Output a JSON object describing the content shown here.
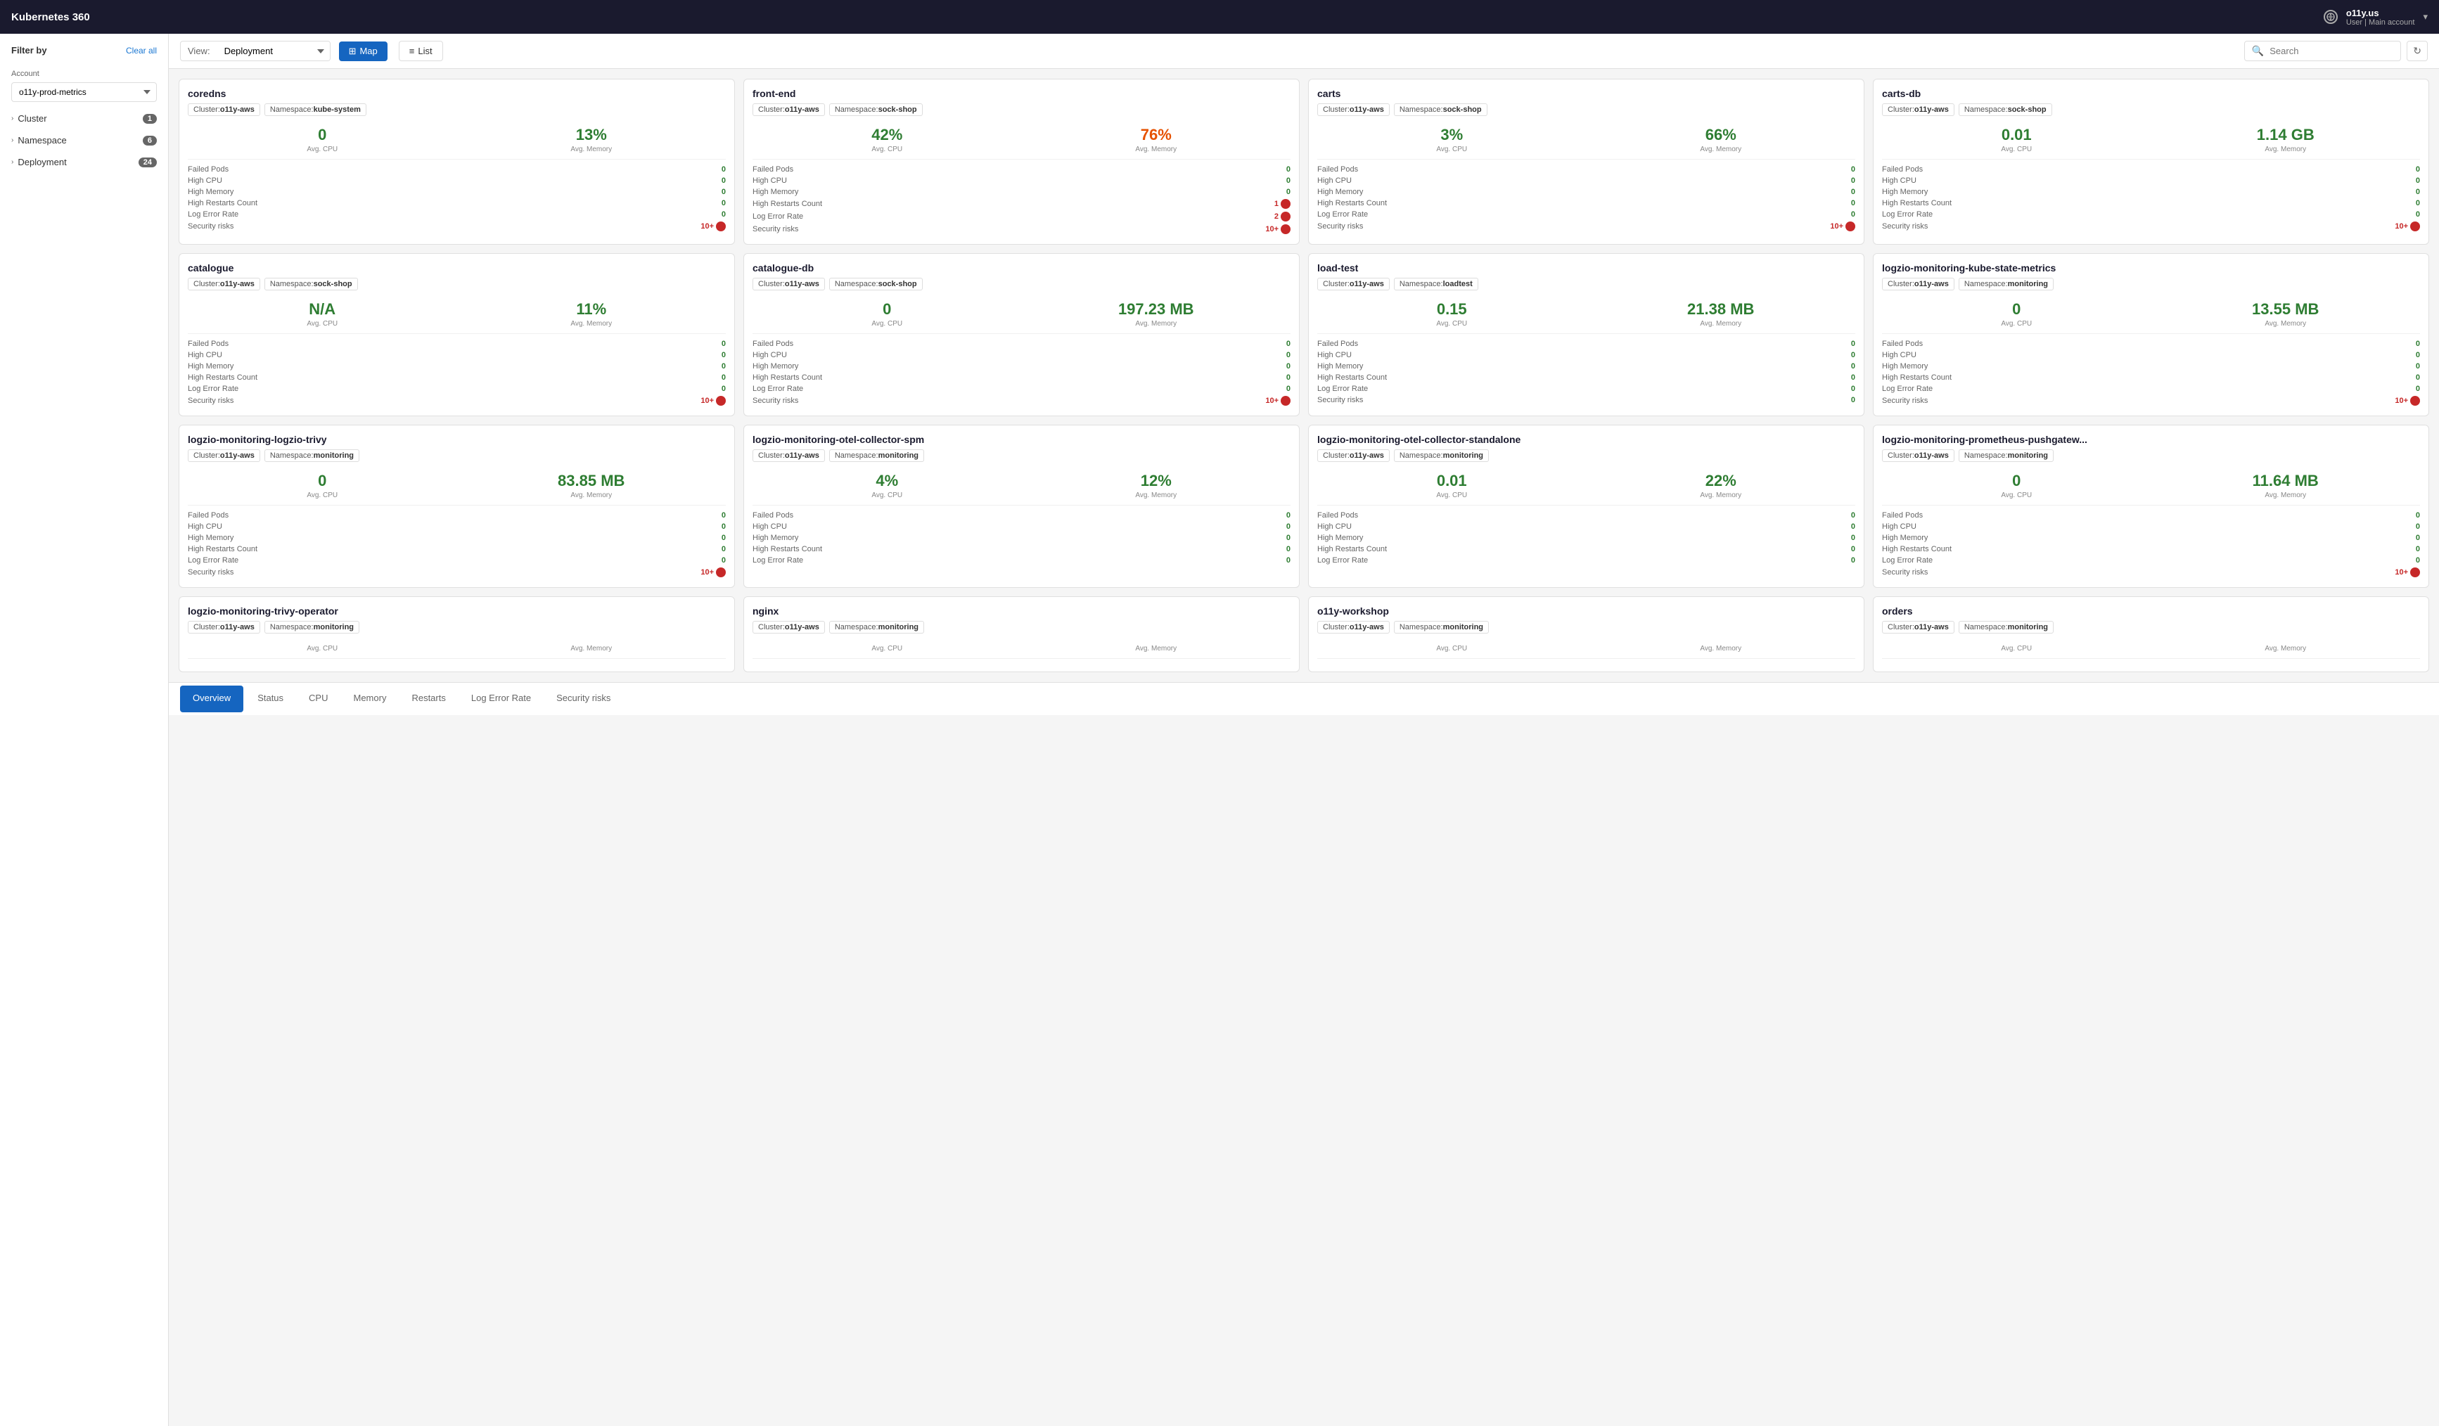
{
  "topbar": {
    "title": "Kubernetes 360",
    "help_label": "Help",
    "user_name": "o11y.us",
    "user_role": "User",
    "user_account": "Main account"
  },
  "sidebar": {
    "filter_title": "Filter by",
    "clear_all_label": "Clear all",
    "account_label": "Account",
    "account_value": "o11y-prod-metrics",
    "filters": [
      {
        "name": "Cluster",
        "count": "1"
      },
      {
        "name": "Namespace",
        "count": "6"
      },
      {
        "name": "Deployment",
        "count": "24"
      }
    ]
  },
  "toolbar": {
    "view_label": "View:",
    "view_value": "Deployment",
    "map_label": "Map",
    "list_label": "List",
    "search_placeholder": "Search",
    "refresh_icon": "↻"
  },
  "cards": [
    {
      "title": "coredns",
      "cluster": "o11y-aws",
      "namespace": "kube-system",
      "cpu": "0",
      "cpu_color": "green",
      "memory": "13%",
      "memory_color": "green",
      "cpu_label": "Avg. CPU",
      "memory_label": "Avg. Memory",
      "rows": [
        {
          "label": "Failed Pods",
          "value": "0",
          "color": "green"
        },
        {
          "label": "High CPU",
          "value": "0",
          "color": "green"
        },
        {
          "label": "High Memory",
          "value": "0",
          "color": "green"
        },
        {
          "label": "High Restarts Count",
          "value": "0",
          "color": "green"
        },
        {
          "label": "Log Error Rate",
          "value": "0",
          "color": "green"
        },
        {
          "label": "Security risks",
          "value": "10+",
          "color": "red",
          "dot": true
        }
      ]
    },
    {
      "title": "front-end",
      "cluster": "o11y-aws",
      "namespace": "sock-shop",
      "cpu": "42%",
      "cpu_color": "green",
      "memory": "76%",
      "memory_color": "orange",
      "cpu_label": "Avg. CPU",
      "memory_label": "Avg. Memory",
      "rows": [
        {
          "label": "Failed Pods",
          "value": "0",
          "color": "green"
        },
        {
          "label": "High CPU",
          "value": "0",
          "color": "green"
        },
        {
          "label": "High Memory",
          "value": "0",
          "color": "green"
        },
        {
          "label": "High Restarts Count",
          "value": "1",
          "color": "red",
          "dot": true
        },
        {
          "label": "Log Error Rate",
          "value": "2",
          "color": "red",
          "dot": true
        },
        {
          "label": "Security risks",
          "value": "10+",
          "color": "red",
          "dot": true
        }
      ]
    },
    {
      "title": "carts",
      "cluster": "o11y-aws",
      "namespace": "sock-shop",
      "cpu": "3%",
      "cpu_color": "green",
      "memory": "66%",
      "memory_color": "green",
      "cpu_label": "Avg. CPU",
      "memory_label": "Avg. Memory",
      "rows": [
        {
          "label": "Failed Pods",
          "value": "0",
          "color": "green"
        },
        {
          "label": "High CPU",
          "value": "0",
          "color": "green"
        },
        {
          "label": "High Memory",
          "value": "0",
          "color": "green"
        },
        {
          "label": "High Restarts Count",
          "value": "0",
          "color": "green"
        },
        {
          "label": "Log Error Rate",
          "value": "0",
          "color": "green"
        },
        {
          "label": "Security risks",
          "value": "10+",
          "color": "red",
          "dot": true
        }
      ]
    },
    {
      "title": "carts-db",
      "cluster": "o11y-aws",
      "namespace": "sock-shop",
      "cpu": "0.01",
      "cpu_color": "green",
      "memory": "1.14 GB",
      "memory_color": "green",
      "cpu_label": "Avg. CPU",
      "memory_label": "Avg. Memory",
      "rows": [
        {
          "label": "Failed Pods",
          "value": "0",
          "color": "green"
        },
        {
          "label": "High CPU",
          "value": "0",
          "color": "green"
        },
        {
          "label": "High Memory",
          "value": "0",
          "color": "green"
        },
        {
          "label": "High Restarts Count",
          "value": "0",
          "color": "green"
        },
        {
          "label": "Log Error Rate",
          "value": "0",
          "color": "green"
        },
        {
          "label": "Security risks",
          "value": "10+",
          "color": "red",
          "dot": true
        }
      ]
    },
    {
      "title": "catalogue",
      "cluster": "o11y-aws",
      "namespace": "sock-shop",
      "cpu": "N/A",
      "cpu_color": "green",
      "memory": "11%",
      "memory_color": "green",
      "cpu_label": "Avg. CPU",
      "memory_label": "Avg. Memory",
      "rows": [
        {
          "label": "Failed Pods",
          "value": "0",
          "color": "green"
        },
        {
          "label": "High CPU",
          "value": "0",
          "color": "green"
        },
        {
          "label": "High Memory",
          "value": "0",
          "color": "green"
        },
        {
          "label": "High Restarts Count",
          "value": "0",
          "color": "green"
        },
        {
          "label": "Log Error Rate",
          "value": "0",
          "color": "green"
        },
        {
          "label": "Security risks",
          "value": "10+",
          "color": "red",
          "dot": true
        }
      ]
    },
    {
      "title": "catalogue-db",
      "cluster": "o11y-aws",
      "namespace": "sock-shop",
      "cpu": "0",
      "cpu_color": "green",
      "memory": "197.23 MB",
      "memory_color": "green",
      "cpu_label": "Avg. CPU",
      "memory_label": "Avg. Memory",
      "rows": [
        {
          "label": "Failed Pods",
          "value": "0",
          "color": "green"
        },
        {
          "label": "High CPU",
          "value": "0",
          "color": "green"
        },
        {
          "label": "High Memory",
          "value": "0",
          "color": "green"
        },
        {
          "label": "High Restarts Count",
          "value": "0",
          "color": "green"
        },
        {
          "label": "Log Error Rate",
          "value": "0",
          "color": "green"
        },
        {
          "label": "Security risks",
          "value": "10+",
          "color": "red",
          "dot": true
        }
      ]
    },
    {
      "title": "load-test",
      "cluster": "o11y-aws",
      "namespace": "loadtest",
      "cpu": "0.15",
      "cpu_color": "green",
      "memory": "21.38 MB",
      "memory_color": "green",
      "cpu_label": "Avg. CPU",
      "memory_label": "Avg. Memory",
      "rows": [
        {
          "label": "Failed Pods",
          "value": "0",
          "color": "green"
        },
        {
          "label": "High CPU",
          "value": "0",
          "color": "green"
        },
        {
          "label": "High Memory",
          "value": "0",
          "color": "green"
        },
        {
          "label": "High Restarts Count",
          "value": "0",
          "color": "green"
        },
        {
          "label": "Log Error Rate",
          "value": "0",
          "color": "green"
        },
        {
          "label": "Security risks",
          "value": "0",
          "color": "green"
        }
      ]
    },
    {
      "title": "logzio-monitoring-kube-state-metrics",
      "cluster": "o11y-aws",
      "namespace": "monitoring",
      "cpu": "0",
      "cpu_color": "green",
      "memory": "13.55 MB",
      "memory_color": "green",
      "cpu_label": "Avg. CPU",
      "memory_label": "Avg. Memory",
      "rows": [
        {
          "label": "Failed Pods",
          "value": "0",
          "color": "green"
        },
        {
          "label": "High CPU",
          "value": "0",
          "color": "green"
        },
        {
          "label": "High Memory",
          "value": "0",
          "color": "green"
        },
        {
          "label": "High Restarts Count",
          "value": "0",
          "color": "green"
        },
        {
          "label": "Log Error Rate",
          "value": "0",
          "color": "green"
        },
        {
          "label": "Security risks",
          "value": "10+",
          "color": "red",
          "dot": true
        }
      ]
    },
    {
      "title": "logzio-monitoring-logzio-trivy",
      "cluster": "o11y-aws",
      "namespace": "monitoring",
      "cpu": "0",
      "cpu_color": "green",
      "memory": "83.85 MB",
      "memory_color": "green",
      "cpu_label": "Avg. CPU",
      "memory_label": "Avg. Memory",
      "rows": [
        {
          "label": "Failed Pods",
          "value": "0",
          "color": "green"
        },
        {
          "label": "High CPU",
          "value": "0",
          "color": "green"
        },
        {
          "label": "High Memory",
          "value": "0",
          "color": "green"
        },
        {
          "label": "High Restarts Count",
          "value": "0",
          "color": "green"
        },
        {
          "label": "Log Error Rate",
          "value": "0",
          "color": "green"
        },
        {
          "label": "Security risks",
          "value": "10+",
          "color": "red",
          "dot": true
        }
      ]
    },
    {
      "title": "logzio-monitoring-otel-collector-spm",
      "cluster": "o11y-aws",
      "namespace": "monitoring",
      "cpu": "4%",
      "cpu_color": "green",
      "memory": "12%",
      "memory_color": "green",
      "cpu_label": "Avg. CPU",
      "memory_label": "Avg. Memory",
      "rows": [
        {
          "label": "Failed Pods",
          "value": "0",
          "color": "green"
        },
        {
          "label": "High CPU",
          "value": "0",
          "color": "green"
        },
        {
          "label": "High Memory",
          "value": "0",
          "color": "green"
        },
        {
          "label": "High Restarts Count",
          "value": "0",
          "color": "green"
        },
        {
          "label": "Log Error Rate",
          "value": "0",
          "color": "green"
        }
      ]
    },
    {
      "title": "logzio-monitoring-otel-collector-standalone",
      "cluster": "o11y-aws",
      "namespace": "monitoring",
      "cpu": "0.01",
      "cpu_color": "green",
      "memory": "22%",
      "memory_color": "green",
      "cpu_label": "Avg. CPU",
      "memory_label": "Avg. Memory",
      "rows": [
        {
          "label": "Failed Pods",
          "value": "0",
          "color": "green"
        },
        {
          "label": "High CPU",
          "value": "0",
          "color": "green"
        },
        {
          "label": "High Memory",
          "value": "0",
          "color": "green"
        },
        {
          "label": "High Restarts Count",
          "value": "0",
          "color": "green"
        },
        {
          "label": "Log Error Rate",
          "value": "0",
          "color": "green"
        }
      ]
    },
    {
      "title": "logzio-monitoring-prometheus-pushgatew...",
      "cluster": "o11y-aws",
      "namespace": "monitoring",
      "cpu": "0",
      "cpu_color": "green",
      "memory": "11.64 MB",
      "memory_color": "green",
      "cpu_label": "Avg. CPU",
      "memory_label": "Avg. Memory",
      "rows": [
        {
          "label": "Failed Pods",
          "value": "0",
          "color": "green"
        },
        {
          "label": "High CPU",
          "value": "0",
          "color": "green"
        },
        {
          "label": "High Memory",
          "value": "0",
          "color": "green"
        },
        {
          "label": "High Restarts Count",
          "value": "0",
          "color": "green"
        },
        {
          "label": "Log Error Rate",
          "value": "0",
          "color": "green"
        },
        {
          "label": "Security risks",
          "value": "10+",
          "color": "red",
          "dot": true
        }
      ]
    },
    {
      "title": "logzio-monitoring-trivy-operator",
      "cluster": "o11y-aws",
      "namespace": "monitoring",
      "cpu": "",
      "cpu_color": "green",
      "memory": "",
      "memory_color": "green",
      "cpu_label": "Avg. CPU",
      "memory_label": "Avg. Memory",
      "rows": []
    },
    {
      "title": "nginx",
      "cluster": "o11y-aws",
      "namespace": "monitoring",
      "cpu": "",
      "cpu_color": "green",
      "memory": "",
      "memory_color": "green",
      "cpu_label": "Avg. CPU",
      "memory_label": "Avg. Memory",
      "rows": []
    },
    {
      "title": "o11y-workshop",
      "cluster": "o11y-aws",
      "namespace": "monitoring",
      "cpu": "",
      "cpu_color": "green",
      "memory": "",
      "memory_color": "green",
      "cpu_label": "Avg. CPU",
      "memory_label": "Avg. Memory",
      "rows": []
    },
    {
      "title": "orders",
      "cluster": "o11y-aws",
      "namespace": "monitoring",
      "cpu": "",
      "cpu_color": "green",
      "memory": "",
      "memory_color": "green",
      "cpu_label": "Avg. CPU",
      "memory_label": "Avg. Memory",
      "rows": []
    }
  ],
  "bottom_tabs": [
    {
      "label": "Overview",
      "active": true
    },
    {
      "label": "Status",
      "active": false
    },
    {
      "label": "CPU",
      "active": false
    },
    {
      "label": "Memory",
      "active": false
    },
    {
      "label": "Restarts",
      "active": false
    },
    {
      "label": "Log Error Rate",
      "active": false
    },
    {
      "label": "Security risks",
      "active": false
    }
  ]
}
